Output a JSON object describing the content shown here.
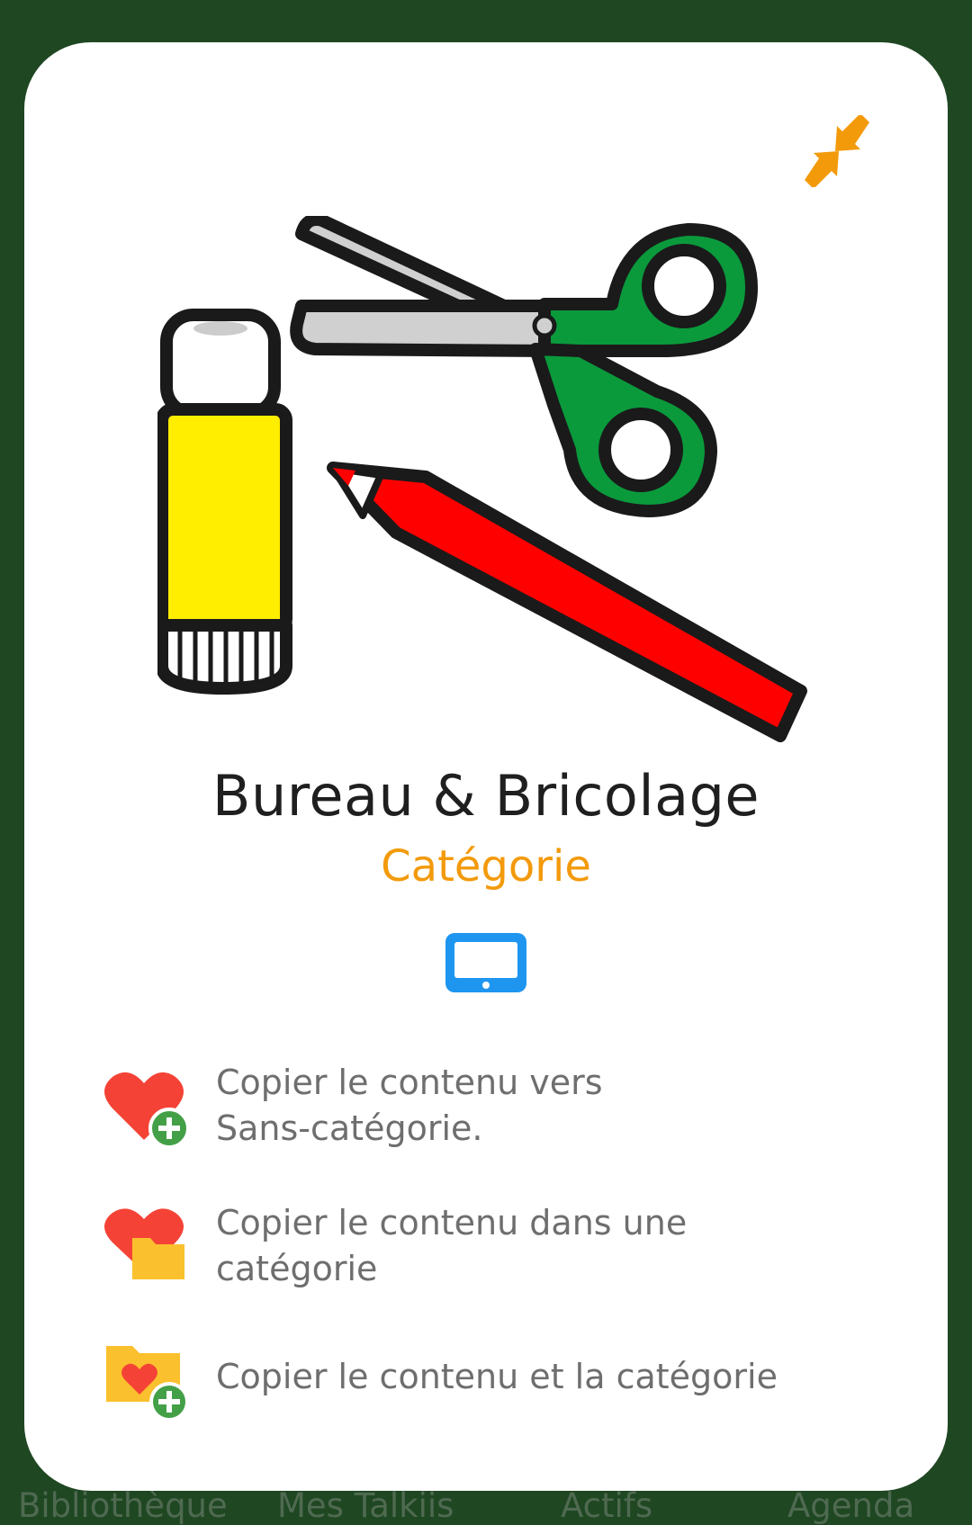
{
  "card": {
    "title": "Bureau & Bricolage",
    "subtitle": "Catégorie"
  },
  "actions": [
    {
      "label_line1": "Copier le contenu vers",
      "label_line2": "Sans-catégorie.",
      "icon": "heart-plus-icon"
    },
    {
      "label_line1": "Copier le contenu dans une",
      "label_line2": "catégorie",
      "icon": "heart-folder-icon"
    },
    {
      "label_line1": "Copier le contenu et la catégorie",
      "icon": "folder-heart-plus-icon"
    }
  ],
  "bottom_nav": {
    "items": [
      "Bibliothèque",
      "Mes Talkiis",
      "Actifs",
      "Agenda"
    ]
  },
  "colors": {
    "background": "#1f4722",
    "accent_orange": "#f39a0b",
    "tablet_blue": "#1e96f0",
    "heart_red": "#f44336",
    "plus_green": "#43a047",
    "folder_yellow": "#fbc02d"
  }
}
